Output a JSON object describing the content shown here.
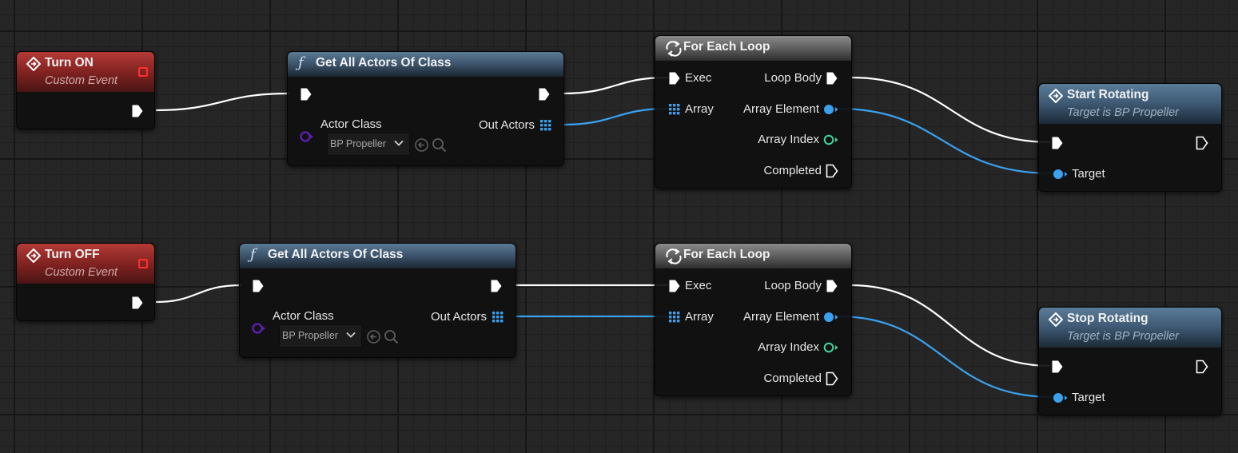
{
  "nodes": {
    "turn_on": {
      "title": "Turn ON",
      "subtitle": "Custom Event"
    },
    "turn_off": {
      "title": "Turn OFF",
      "subtitle": "Custom Event"
    },
    "get_actors_1": {
      "title": "Get All Actors Of Class",
      "actor_class_label": "Actor Class",
      "actor_class_value": "BP Propeller",
      "out_label": "Out Actors"
    },
    "get_actors_2": {
      "title": "Get All Actors Of Class",
      "actor_class_label": "Actor Class",
      "actor_class_value": "BP Propeller",
      "out_label": "Out Actors"
    },
    "foreach_1": {
      "title": "For Each Loop",
      "exec": "Exec",
      "array": "Array",
      "loop_body": "Loop Body",
      "array_element": "Array Element",
      "array_index": "Array Index",
      "completed": "Completed"
    },
    "foreach_2": {
      "title": "For Each Loop",
      "exec": "Exec",
      "array": "Array",
      "loop_body": "Loop Body",
      "array_element": "Array Element",
      "array_index": "Array Index",
      "completed": "Completed"
    },
    "start_rotating": {
      "title": "Start Rotating",
      "subtitle": "Target is BP Propeller",
      "target": "Target"
    },
    "stop_rotating": {
      "title": "Stop Rotating",
      "subtitle": "Target is BP Propeller",
      "target": "Target"
    }
  },
  "icons": {
    "event": "event-diamond-icon",
    "function": "function-f-icon",
    "loop": "loop-arrows-icon",
    "exec_pin": "exec-arrow-pin",
    "object_pin": "object-dot-pin",
    "array_pin": "array-grid-pin",
    "class_pin": "class-ring-pin",
    "reset": "reset-arrow-icon",
    "browse": "search-icon"
  },
  "colors": {
    "event_header": "#7c211f",
    "function_header": "#3b536a",
    "macro_header": "#5e5e5e",
    "exec_wire": "#ffffff",
    "object_wire": "#3aa1ee",
    "class_pin": "#5a1fa8",
    "index_pin": "#3fd69c"
  }
}
